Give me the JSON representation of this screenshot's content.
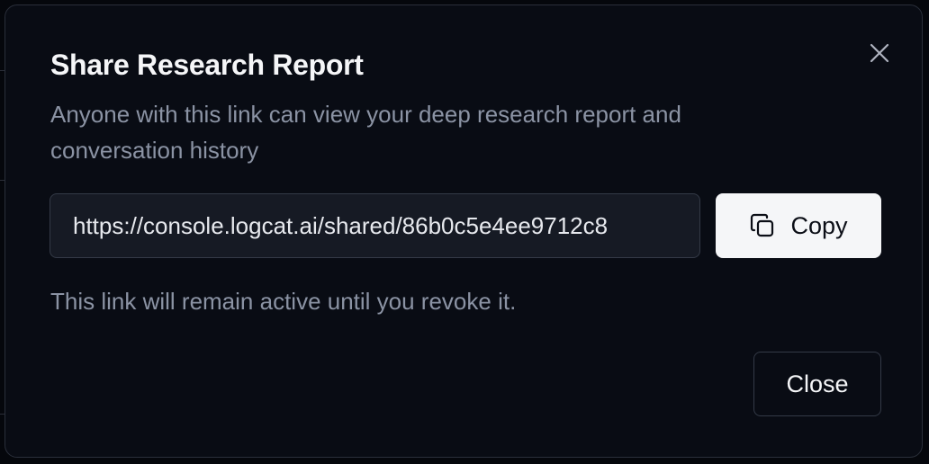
{
  "dialog": {
    "title": "Share Research Report",
    "description": "Anyone with this link can view your deep research report and conversation history",
    "link_value": "https://console.logcat.ai/shared/86b0c5e4ee9712c8",
    "copy_label": "Copy",
    "note": "This link will remain active until you revoke it.",
    "close_label": "Close"
  },
  "icons": {
    "dismiss": "close-icon",
    "copy": "copy-icon"
  },
  "colors": {
    "background": "#090c14",
    "title_text": "#f5f6f8",
    "muted_text": "#8b93a4",
    "input_background": "#161a24",
    "border": "#343a47",
    "primary_button": "#f5f6f8"
  }
}
